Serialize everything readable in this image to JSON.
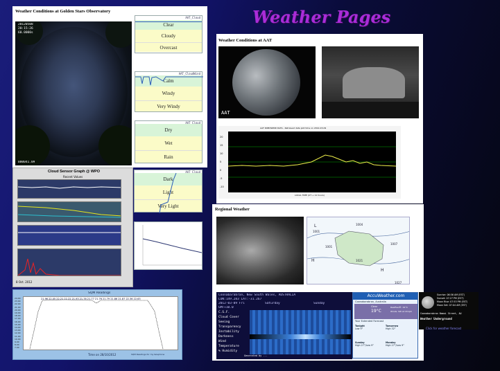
{
  "header": {
    "title": "Weather Pages"
  },
  "gso": {
    "caption": "Weather Conditions at Golden Stars Observatory",
    "cam_text": [
      "20120508",
      "20:15:26",
      "60.0000s"
    ],
    "cam_bottom": "000041.09",
    "gauges": [
      {
        "title": "AAT_Cloud",
        "labels": [
          "Clear",
          "Cloudy",
          "Overcast"
        ]
      },
      {
        "title": "AAT_CloudWind",
        "labels": [
          "Calm",
          "Windy",
          "Very Windy"
        ]
      },
      {
        "title": "AAT_Cloud",
        "labels": [
          "Dry",
          "Wet",
          "Rain"
        ]
      },
      {
        "title": "AAT_Cloud",
        "labels": [
          "Dark",
          "Light",
          "Very Light"
        ]
      }
    ]
  },
  "cloud_sensor": {
    "title": "Cloud Sensor Graph @ WPO",
    "date": "8 Oct. 2012",
    "sub": "Recent Values"
  },
  "sqm": {
    "title": "SQM Readings",
    "footer": "Time on 28/10/2012",
    "legend": "SQM Readings for my telephone",
    "ylabel": "Mag/Sq Arcsec",
    "top_values": "21.96 22.05 22.21 22.22 21.93  21.76 21.77 21.76 21.79 21.86 21.87  22.36 22.63",
    "y_ticks": [
      "24.00",
      "23.00",
      "22.00",
      "21.00",
      "20.00",
      "19.00",
      "18.00",
      "17.00",
      "16.00",
      "15.00",
      "14.00",
      "13.00",
      "12.00",
      "11.00",
      "10.00",
      "9.00",
      "8.00",
      "7.00"
    ]
  },
  "aat": {
    "caption": "Weather Conditions at AAT",
    "allsky_label": "AAT",
    "plot_title": "AAT ROBOWIND DATA - Retrieved data plot time on 2012-03-09",
    "xlabel": "LOCAL TIME (UT + 11 hours)",
    "y_ticks": [
      "20",
      "15",
      "10",
      "5",
      "0",
      "-5",
      "-10"
    ]
  },
  "regional": {
    "caption": "Regional Weather",
    "map_labels": [
      {
        "t": "L\n1001"
      },
      {
        "t": "1004"
      },
      {
        "t": "1001"
      },
      {
        "t": "L"
      },
      {
        "t": "1007"
      },
      {
        "t": "H\n1021"
      },
      {
        "t": "1021"
      },
      {
        "t": "H\n1021"
      },
      {
        "t": "H\n1027"
      }
    ]
  },
  "clear_sky": {
    "location": "Coonabarabran, New South Wales, AUSTRALIA",
    "coords": "LON:149.283 LAT:-31.267",
    "date": "2012-03-09 Fri",
    "sat": "Saturday",
    "sun": "Sunday",
    "gmt": "GMT+10.0",
    "rows": [
      "C.S.F.",
      "Cloud Cover",
      "Seeing",
      "Transparency",
      "Instability",
      "Darkness",
      "Wind",
      "Temperature",
      "% Humidity"
    ],
    "footer": "Generated by ..."
  },
  "accu": {
    "brand": "AccuWeather.com",
    "place": "Coonabarabran, Australia",
    "condition": "Clear",
    "temp": "19°C",
    "realfeel": "RealFeel®: 19°C",
    "wind": "Winds: SW at 18 kph",
    "forecast_title": "Your Extended Forecast",
    "days": [
      "Tonight",
      "Tomorrow",
      "Sunday",
      "Monday"
    ],
    "day_vals": [
      "Low 9°",
      "High 32°",
      "High 27°/Low 9°",
      "High 27°/Low 9°"
    ]
  },
  "wu": {
    "rows": [
      "Sunrise: 06:56 AM (EST)",
      "Sunset: 07:27 PM (EST)",
      "Moon Rise: 07:53 PM (EST)",
      "Moon Set: 07:04 AM (EST)"
    ],
    "station": "Coonabarabran Namoi Street, AU",
    "brand": "Weather Underground",
    "link": "Click for weather forecast"
  }
}
